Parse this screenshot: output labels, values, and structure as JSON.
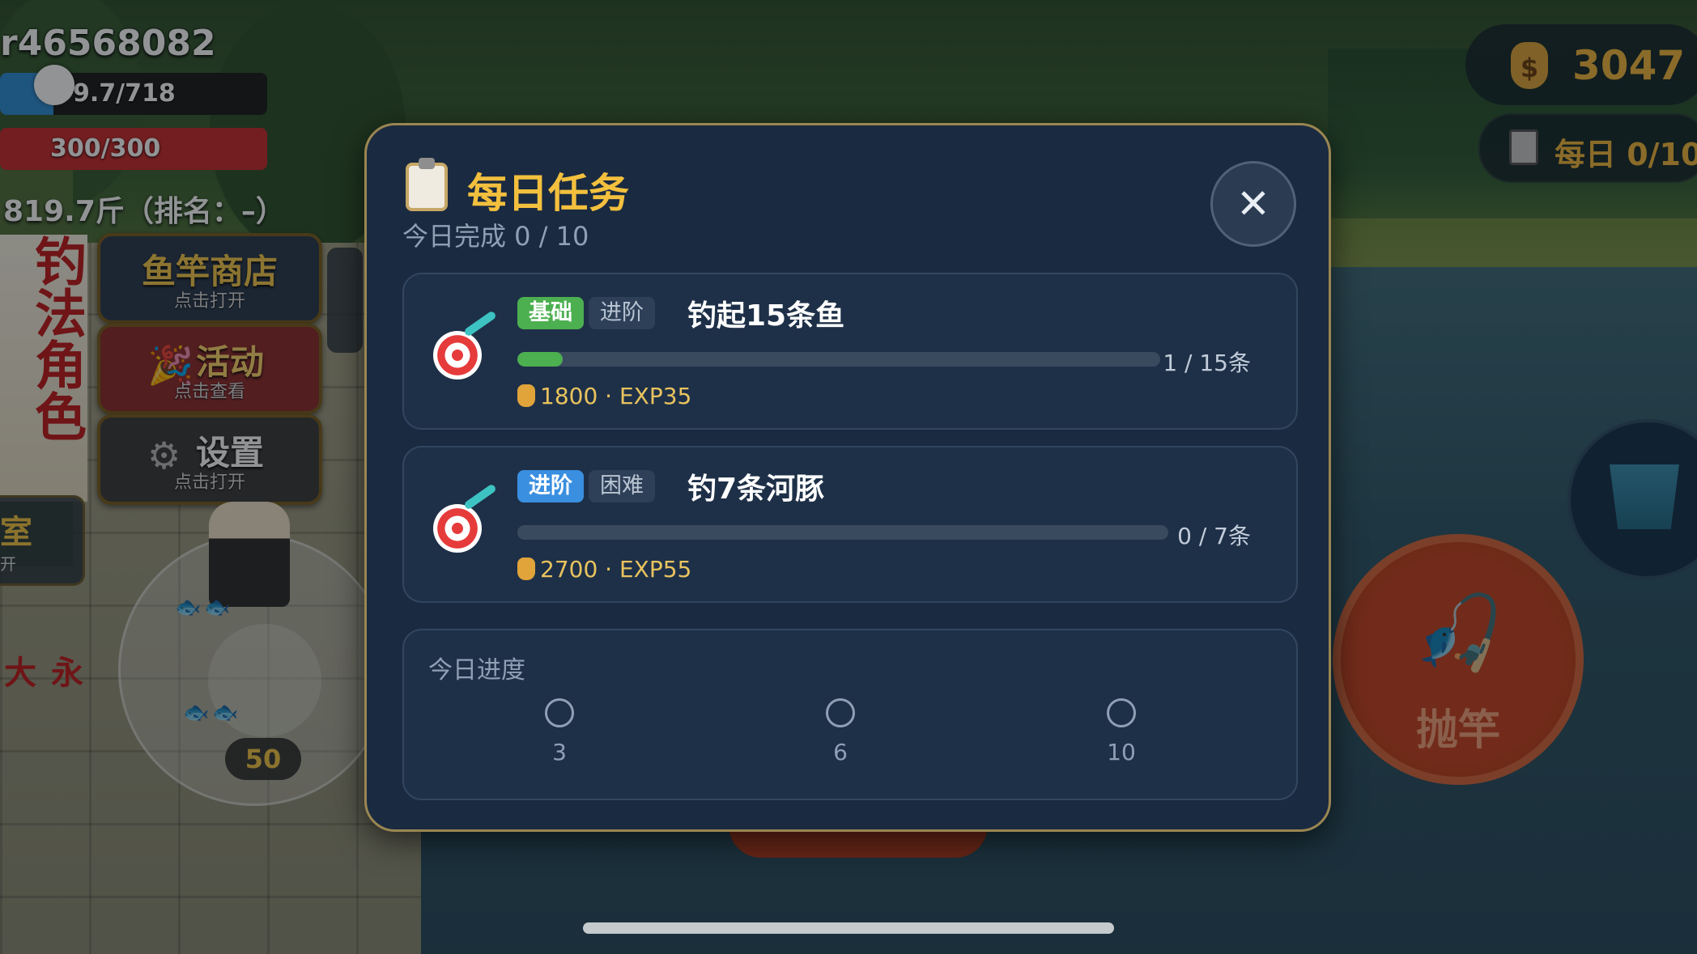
{
  "hud": {
    "player_id": "r46568082",
    "exp_text": "9.7/718",
    "exp_progress": 0.2,
    "hp_text": "300/300",
    "weight_rank_text": "819.7斤（排名：–）",
    "banner_text": "钓法角色",
    "banner_sub": "永大樂曲",
    "side_tab": {
      "label": "室",
      "sub": "开"
    },
    "menu": [
      {
        "label": "鱼竿商店",
        "sub": "点击打开",
        "icon": "shop-icon"
      },
      {
        "label": "活动",
        "sub": "点击查看",
        "icon": "party-popper-icon"
      },
      {
        "label": "设置",
        "sub": "点击打开",
        "icon": "gear-icon"
      }
    ],
    "bait_count": "50",
    "coins": "3047",
    "daily_pill_text": "每日 0/10",
    "cast_label": "抛竿",
    "colors": {
      "gold": "#f3b73b",
      "cast": "#c7431f"
    }
  },
  "modal": {
    "title": "每日任务",
    "subtitle": "今日完成 0 / 10",
    "close_glyph": "✕",
    "tasks": [
      {
        "tag_primary": "基础",
        "tag_secondary": "进阶",
        "name": "钓起15条鱼",
        "progress_text": "1 / 15条",
        "progress": 0.0667,
        "reward_coins": "1800",
        "reward_exp": "EXP35",
        "reward_text": "1800 · EXP35"
      },
      {
        "tag_primary": "进阶",
        "tag_secondary": "困难",
        "name": "钓7条河豚",
        "progress_text": "0 / 7条",
        "progress": 0,
        "reward_coins": "2700",
        "reward_exp": "EXP55",
        "reward_text": "2700 · EXP55"
      }
    ],
    "daily_progress": {
      "label": "今日进度",
      "milestones": [
        "3",
        "6",
        "10"
      ]
    }
  }
}
